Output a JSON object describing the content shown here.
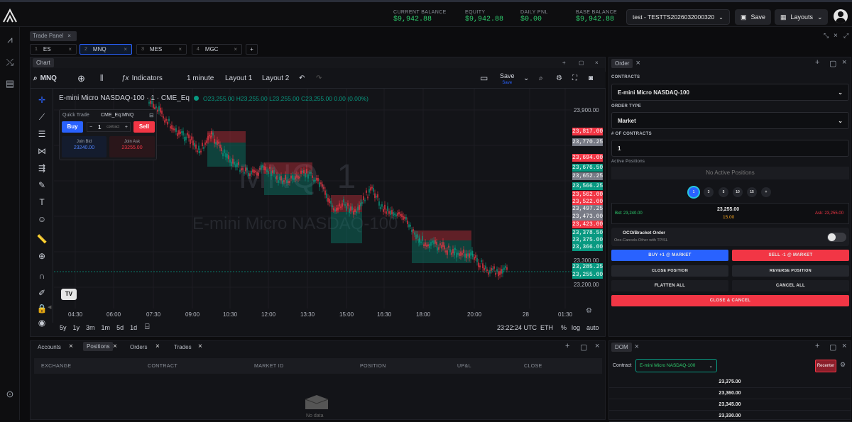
{
  "balances": [
    {
      "label": "CURRENT BALANCE",
      "value": "$9,942.88"
    },
    {
      "label": "EQUITY",
      "value": "$9,942.88"
    },
    {
      "label": "DAILY PNL",
      "value": "$0.00"
    },
    {
      "label": "BASE BALANCE",
      "value": "$9,942.88"
    }
  ],
  "account": "test - TESTTS2026032000320",
  "save_label": "Save",
  "layouts_label": "Layouts",
  "trade_panel_label": "Trade Panel",
  "symbol_tabs": [
    {
      "num": "1",
      "sym": "ES",
      "active": false
    },
    {
      "num": "2",
      "sym": "MNQ",
      "active": true
    },
    {
      "num": "3",
      "sym": "MES",
      "active": false
    },
    {
      "num": "4",
      "sym": "MGC",
      "active": false
    }
  ],
  "chart": {
    "tab_label": "Chart",
    "symbol": "MNQ",
    "indicators_label": "Indicators",
    "interval": "1 minute",
    "layout1": "Layout 1",
    "layout2": "Layout 2",
    "save_label": "Save",
    "save_sub": "Save",
    "legend_title": "E-mini Micro NASDAQ-100 · 1 · CME_Eq",
    "ohlc": {
      "o": "23,255.00",
      "h": "23,255.00",
      "l": "23,255.00",
      "c": "23,255.00",
      "chg": "0.00 (0.00%)"
    },
    "watermark_big": "MNQ, 1",
    "watermark_small": "E-mini Micro NASDAQ-100",
    "time_labels": [
      "04:30",
      "06:00",
      "07:30",
      "09:00",
      "10:30",
      "12:00",
      "13:30",
      "15:00",
      "16:30",
      "18:00",
      "20:00",
      "28",
      "01:30"
    ],
    "price_ticks": [
      "23,900.00",
      "23,300.00",
      "23,200.00"
    ],
    "price_labels": [
      {
        "v": "23,817.00",
        "c": "#f23645"
      },
      {
        "v": "23,770.25",
        "c": "#787b86"
      },
      {
        "v": "23,694.00",
        "c": "#f23645"
      },
      {
        "v": "23,676.50",
        "c": "#089981"
      },
      {
        "v": "23,652.25",
        "c": "#787b86"
      },
      {
        "v": "23,566.25",
        "c": "#089981"
      },
      {
        "v": "23,562.00",
        "c": "#f23645"
      },
      {
        "v": "23,522.00",
        "c": "#f23645"
      },
      {
        "v": "23,497.25",
        "c": "#787b86"
      },
      {
        "v": "23,473.00",
        "c": "#787b86"
      },
      {
        "v": "23,423.00",
        "c": "#f23645"
      },
      {
        "v": "23,378.50",
        "c": "#089981"
      },
      {
        "v": "23,375.00",
        "c": "#089981"
      },
      {
        "v": "23,366.00",
        "c": "#089981"
      },
      {
        "v": "23,285.25",
        "c": "#089981"
      },
      {
        "v": "23,255.00",
        "c": "#089981"
      }
    ],
    "ranges": [
      "5y",
      "1y",
      "3m",
      "1m",
      "5d",
      "1d"
    ],
    "clock": "23:22:24 UTC",
    "session": "ETH",
    "pct": "%",
    "log": "log",
    "auto": "auto",
    "quick_trade": {
      "title": "Quick Trade",
      "symbol": "CME_Eq:MNQ",
      "buy": "Buy",
      "sell": "Sell",
      "qty": "1",
      "unit": "contract",
      "join_bid_label": "Join Bid",
      "join_bid": "23240.00",
      "join_ask_label": "Join Ask",
      "join_ask": "23255.00"
    }
  },
  "positions_panel": {
    "tabs": [
      "Accounts",
      "Positions",
      "Orders",
      "Trades"
    ],
    "headers": [
      "EXCHANGE",
      "CONTRACT",
      "MARKET ID",
      "POSITION",
      "UP&L",
      "CLOSE"
    ],
    "empty": "No data"
  },
  "order": {
    "tab_label": "Order",
    "contracts_label": "CONTRACTS",
    "contract": "E-mini Micro NASDAQ-100",
    "order_type_label": "ORDER TYPE",
    "order_type": "Market",
    "num_label": "# OF CONTRACTS",
    "num": "1",
    "active_label": "Active Positions",
    "no_active": "No Active Positions",
    "qty_presets": [
      "1",
      "3",
      "5",
      "10",
      "15",
      "+"
    ],
    "bid": "Bid: 23,240.00",
    "last": "23,255.00",
    "spread": "15.00",
    "ask": "Ask: 23,255.00",
    "oco_title": "OCO/Bracket Order",
    "oco_sub": "One-Cancels-Other with TP/SL",
    "buy_btn": "BUY +1 @ MARKET",
    "sell_btn": "SELL -1 @ MARKET",
    "close_pos": "CLOSE POSITION",
    "reverse_pos": "REVERSE POSITION",
    "flatten": "FLATTEN ALL",
    "cancel_all": "CANCEL ALL",
    "close_cancel": "CLOSE & CANCEL"
  },
  "dom": {
    "tab_label": "DOM",
    "contract_label": "Contract",
    "contract": "E-mini Micro NASDAQ-100",
    "recenter": "Recenter",
    "rows": [
      "23,375.00",
      "23,360.00",
      "23,345.00",
      "23,330.00"
    ]
  },
  "colors": {
    "up": "#089981",
    "down": "#f23645",
    "accent": "#2962ff",
    "balance": "#2fd06f"
  }
}
